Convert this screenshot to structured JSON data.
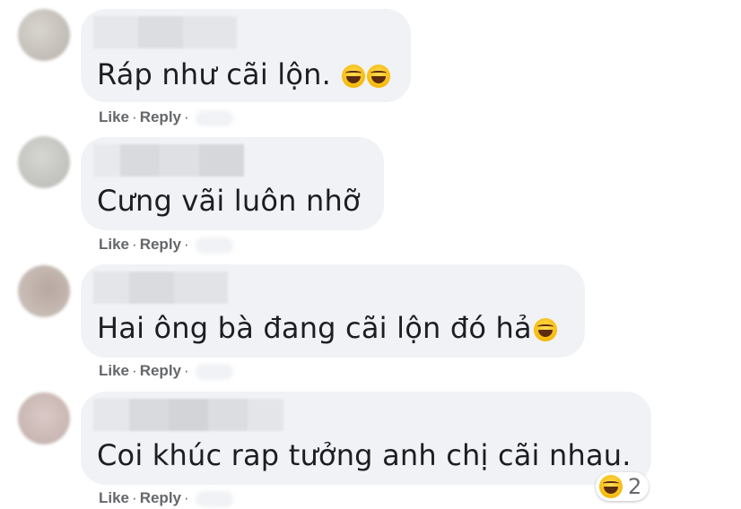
{
  "comments": [
    {
      "text": "Ráp như cãi lộn.",
      "emoji_count": 2
    },
    {
      "text": "Cưng vãi luôn nhỡ",
      "emoji_count": 0
    },
    {
      "text": "Hai ông bà đang cãi lộn đó hả",
      "emoji_count": 1
    },
    {
      "text": "Coi khúc rap tưởng anh chị cãi nhau.",
      "emoji_count": 0
    }
  ],
  "actions": {
    "like": "Like",
    "reply": "Reply",
    "sep": "·"
  },
  "reaction": {
    "icon": "laughing-emoji-icon",
    "count": "2"
  },
  "colors": {
    "bubble": "#f0f2f5",
    "text": "#1c1e21",
    "meta": "#65676b"
  }
}
